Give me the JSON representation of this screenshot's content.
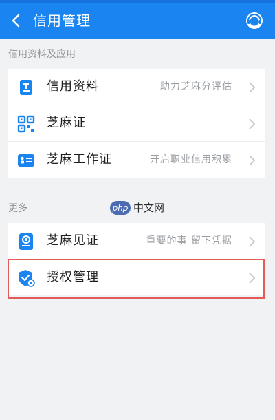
{
  "header": {
    "title": "信用管理"
  },
  "sections": [
    {
      "label": "信用资料及应用",
      "items": [
        {
          "label": "信用资料",
          "hint": "助力芝麻分评估",
          "icon": "credit-document-icon"
        },
        {
          "label": "芝麻证",
          "hint": "",
          "icon": "qr-code-icon"
        },
        {
          "label": "芝麻工作证",
          "hint": "开启职业信用积累",
          "icon": "work-badge-icon"
        }
      ]
    },
    {
      "label": "更多",
      "items": [
        {
          "label": "芝麻见证",
          "hint": "重要的事 留下凭据",
          "icon": "witness-icon"
        },
        {
          "label": "授权管理",
          "hint": "",
          "icon": "shield-check-icon"
        }
      ]
    }
  ],
  "watermark": {
    "badge": "php",
    "text": "中文网"
  },
  "colors": {
    "header": "#1a84f0",
    "icon": "#1a84f0",
    "highlight": "#e25b5b",
    "background": "#f1f2f4"
  }
}
